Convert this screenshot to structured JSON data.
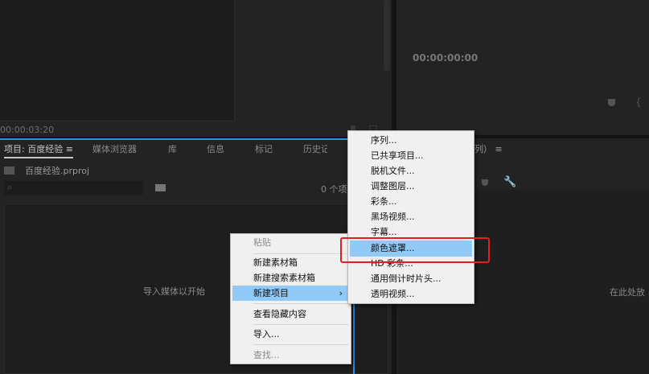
{
  "source_monitor": {
    "timecode": "00:00:03:20"
  },
  "program_monitor": {
    "timecode": "00:00:00:00"
  },
  "project_panel": {
    "tabs": [
      "项目: 百度经验",
      "媒体浏览器",
      "库",
      "信息",
      "标记",
      "历史记"
    ],
    "project_file": "百度经验.prproj",
    "item_count": "0 个项",
    "empty_message": "导入媒体以开始"
  },
  "timeline_panel": {
    "title_fragment": "列）",
    "drop_message": "在此处放"
  },
  "context_menu": {
    "items": [
      "粘贴",
      "新建素材箱",
      "新建搜索素材箱",
      "新建项目",
      "查看隐藏内容",
      "导入...",
      "查找..."
    ],
    "submenu_arrow": "›"
  },
  "submenu": {
    "items": [
      "序列...",
      "已共享项目...",
      "脱机文件...",
      "调整图层...",
      "彩条...",
      "黑场视频...",
      "字幕...",
      "颜色遮罩...",
      "HD 彩条...",
      "通用倒计时片头...",
      "透明视频..."
    ]
  },
  "colors": {
    "highlight": "#91c9f7",
    "annotation": "#e02020",
    "accent": "#2d8ceb"
  }
}
